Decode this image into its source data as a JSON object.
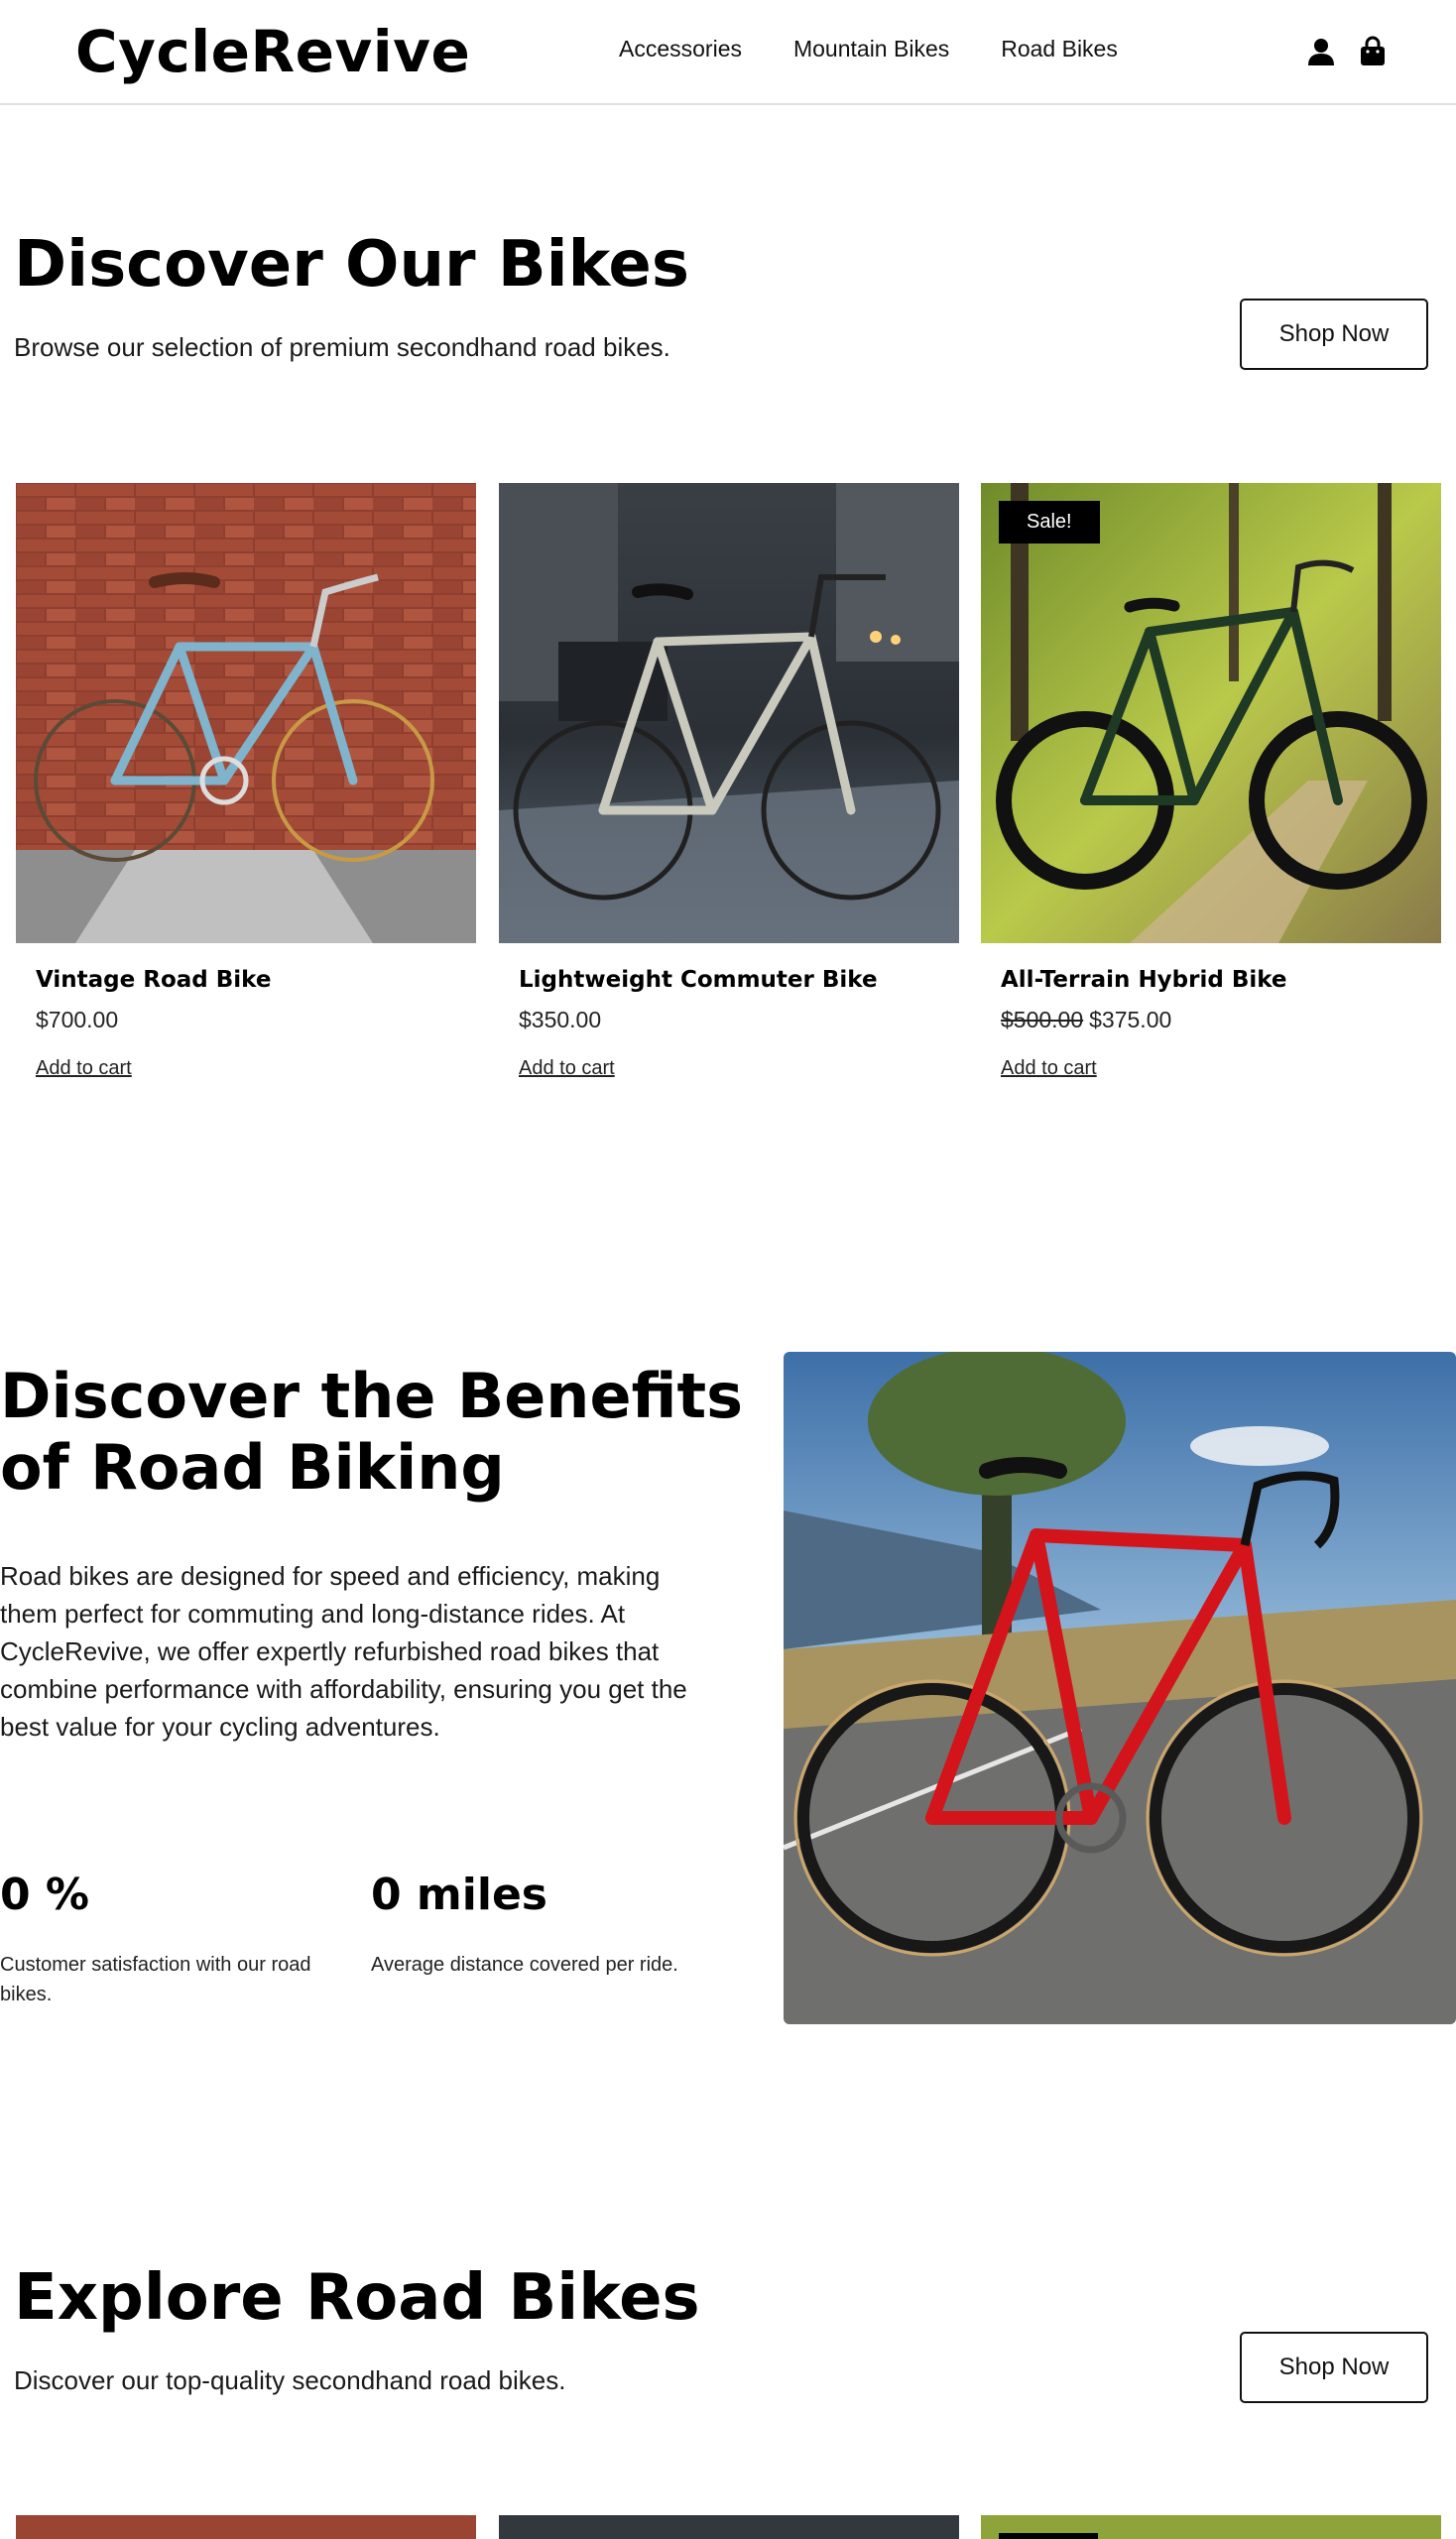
{
  "header": {
    "logo": "CycleRevive",
    "nav": [
      "Accessories",
      "Mountain Bikes",
      "Road Bikes"
    ],
    "icons": [
      "user-icon",
      "shopping-bag-icon"
    ]
  },
  "discover": {
    "title": "Discover Our Bikes",
    "subtitle": "Browse our selection of premium secondhand road bikes.",
    "button": "Shop Now"
  },
  "products": [
    {
      "name": "Vintage Road Bike",
      "price": "$700.00",
      "old_price": "",
      "sale": "",
      "cart": "Add to cart",
      "frame_color": "#7fb4cc",
      "bg": "brick-wall"
    },
    {
      "name": "Lightweight Commuter Bike",
      "price": "$350.00",
      "old_price": "",
      "sale": "",
      "cart": "Add to cart",
      "frame_color": "#c9c9bd",
      "bg": "city-street"
    },
    {
      "name": "All-Terrain Hybrid Bike",
      "price": "$375.00",
      "old_price": "$500.00",
      "sale": "Sale!",
      "cart": "Add to cart",
      "frame_color": "#1f3a24",
      "bg": "forest-trail"
    }
  ],
  "benefits": {
    "title_line1": "Discover the Benefits",
    "title_line2": "of Road Biking",
    "text": "Road bikes are designed for speed and efficiency, making them perfect for commuting and long-distance rides. At CycleRevive, we offer expertly refurbished road bikes that combine performance with affordability, ensuring you get the best value for your cycling adventures.",
    "stats": [
      {
        "value": "0 %",
        "label": "Customer satisfaction with our road bikes."
      },
      {
        "value": "0 miles",
        "label": "Average distance covered per ride."
      }
    ],
    "image_frame_color": "#d4141b"
  },
  "explore": {
    "title": "Explore Road Bikes",
    "subtitle": "Discover our top-quality secondhand road bikes.",
    "button": "Shop Now"
  }
}
